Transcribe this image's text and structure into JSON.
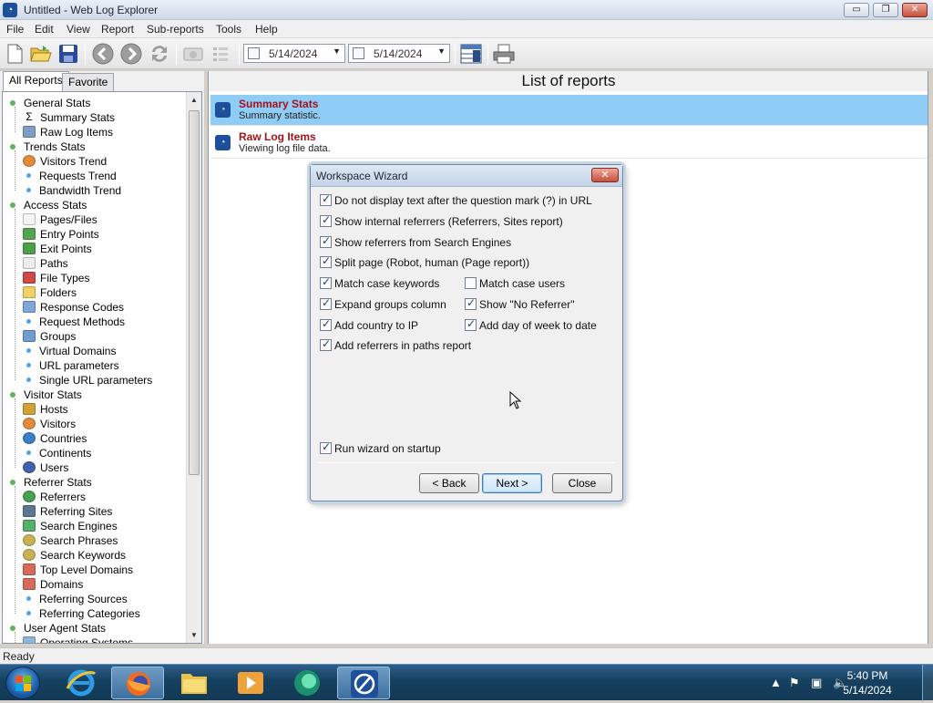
{
  "window": {
    "title": "Untitled - Web Log Explorer",
    "minimize": "▭",
    "maximize": "❐",
    "close": "✕"
  },
  "menu": [
    "File",
    "Edit",
    "View",
    "Report",
    "Sub-reports",
    "Tools",
    "Help"
  ],
  "toolbar": {
    "date_from": "5/14/2024",
    "date_to": "5/14/2024"
  },
  "left_tabs": [
    "All Reports",
    "Favorite"
  ],
  "tree": [
    {
      "label": "General Stats",
      "level": 0,
      "icon": "green-dot"
    },
    {
      "label": "Summary Stats",
      "level": 1,
      "icon": "sigma-icon"
    },
    {
      "label": "Raw Log Items",
      "level": 1,
      "icon": "table-icon"
    },
    {
      "label": "Trends Stats",
      "level": 0,
      "icon": "green-dot"
    },
    {
      "label": "Visitors Trend",
      "level": 1,
      "icon": "person-icon"
    },
    {
      "label": "Requests Trend",
      "level": 1,
      "icon": "blue-dot"
    },
    {
      "label": "Bandwidth Trend",
      "level": 1,
      "icon": "blue-dot"
    },
    {
      "label": "Access Stats",
      "level": 0,
      "icon": "green-dot"
    },
    {
      "label": "Pages/Files",
      "level": 1,
      "icon": "page-icon"
    },
    {
      "label": "Entry Points",
      "level": 1,
      "icon": "entry-icon"
    },
    {
      "label": "Exit Points",
      "level": 1,
      "icon": "exit-icon"
    },
    {
      "label": "Paths",
      "level": 1,
      "icon": "paths-icon"
    },
    {
      "label": "File Types",
      "level": 1,
      "icon": "filetypes-icon"
    },
    {
      "label": "Folders",
      "level": 1,
      "icon": "folder-icon"
    },
    {
      "label": "Response Codes",
      "level": 1,
      "icon": "response-icon"
    },
    {
      "label": "Request Methods",
      "level": 1,
      "icon": "blue-dot"
    },
    {
      "label": "Groups",
      "level": 1,
      "icon": "groups-icon"
    },
    {
      "label": "Virtual Domains",
      "level": 1,
      "icon": "blue-dot"
    },
    {
      "label": "URL parameters",
      "level": 1,
      "icon": "blue-dot"
    },
    {
      "label": "Single URL parameters",
      "level": 1,
      "icon": "blue-dot"
    },
    {
      "label": "Visitor Stats",
      "level": 0,
      "icon": "green-dot"
    },
    {
      "label": "Hosts",
      "level": 1,
      "icon": "hosts-icon"
    },
    {
      "label": "Visitors",
      "level": 1,
      "icon": "person-icon"
    },
    {
      "label": "Countries",
      "level": 1,
      "icon": "globe-icon"
    },
    {
      "label": "Continents",
      "level": 1,
      "icon": "blue-dot"
    },
    {
      "label": "Users",
      "level": 1,
      "icon": "user-icon"
    },
    {
      "label": "Referrer Stats",
      "level": 0,
      "icon": "green-dot"
    },
    {
      "label": "Referrers",
      "level": 1,
      "icon": "referrers-icon"
    },
    {
      "label": "Referring Sites",
      "level": 1,
      "icon": "monitor-icon"
    },
    {
      "label": "Search Engines",
      "level": 1,
      "icon": "search-engine-icon"
    },
    {
      "label": "Search Phrases",
      "level": 1,
      "icon": "magnifier-icon"
    },
    {
      "label": "Search Keywords",
      "level": 1,
      "icon": "magnifier-icon"
    },
    {
      "label": "Top Level Domains",
      "level": 1,
      "icon": "grid-icon"
    },
    {
      "label": "Domains",
      "level": 1,
      "icon": "grid-icon"
    },
    {
      "label": "Referring Sources",
      "level": 1,
      "icon": "blue-dot"
    },
    {
      "label": "Referring Categories",
      "level": 1,
      "icon": "blue-dot"
    },
    {
      "label": "User Agent Stats",
      "level": 0,
      "icon": "green-dot"
    },
    {
      "label": "Operating Systems",
      "level": 1,
      "icon": "os-icon"
    }
  ],
  "right_pane": {
    "header": "List of reports",
    "reports": [
      {
        "title": "Summary Stats",
        "desc": "Summary statistic.",
        "selected": true
      },
      {
        "title": "Raw Log Items",
        "desc": "Viewing log file data.",
        "selected": false
      }
    ]
  },
  "dialog": {
    "title": "Workspace Wizard",
    "close": "✕",
    "options_full": [
      {
        "label": "Do not display text after the question mark (?) in URL",
        "checked": true
      },
      {
        "label": "Show internal referrers (Referrers, Sites report)",
        "checked": true
      },
      {
        "label": "Show referrers from Search Engines",
        "checked": true
      },
      {
        "label": "Split page (Robot, human (Page report))",
        "checked": true
      }
    ],
    "options_grid": [
      {
        "label": "Match case keywords",
        "checked": true
      },
      {
        "label": "Match case users",
        "checked": false
      },
      {
        "label": "Expand groups column",
        "checked": true
      },
      {
        "label": "Show \"No Referrer\"",
        "checked": true
      },
      {
        "label": "Add country to IP",
        "checked": true
      },
      {
        "label": "Add day of week to date",
        "checked": true
      },
      {
        "label": "Add referrers in paths report",
        "checked": true
      }
    ],
    "run_on_startup": {
      "label": "Run wizard on startup",
      "checked": true
    },
    "buttons": {
      "back": "< Back",
      "next": "Next >",
      "close": "Close"
    }
  },
  "status": {
    "text": "Ready"
  },
  "taskbar": {
    "apps": [
      "internet-explorer-icon",
      "firefox-icon",
      "file-explorer-icon",
      "media-player-icon",
      "green-app-icon",
      "web-log-explorer-icon"
    ],
    "time": "5:40 PM",
    "date": "5/14/2024"
  }
}
